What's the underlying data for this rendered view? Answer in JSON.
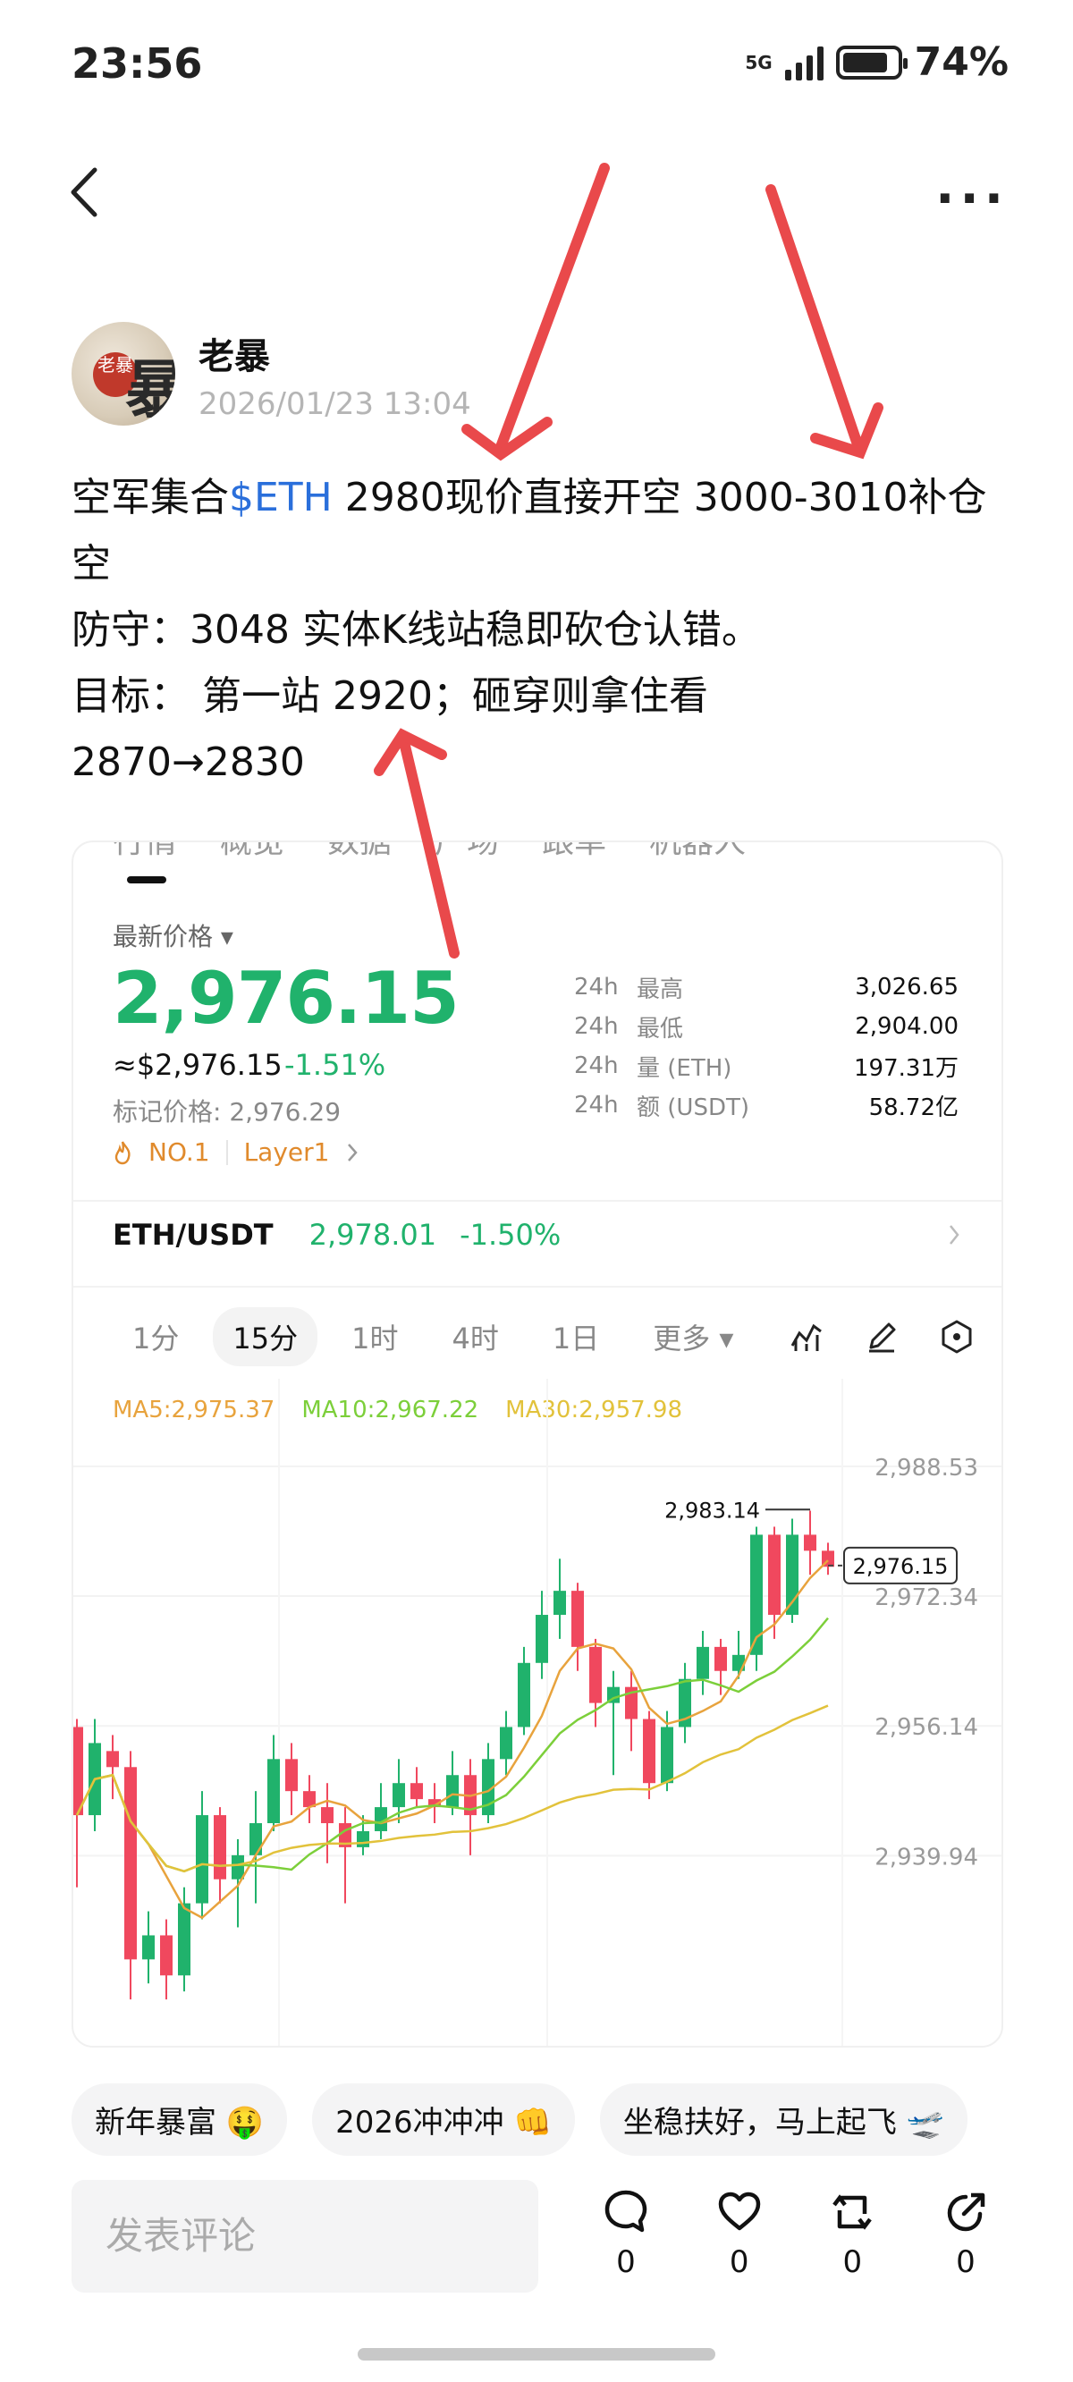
{
  "status": {
    "time": "23:56",
    "network": "5G",
    "battery": "74%",
    "battery_level": 0.74
  },
  "header": {
    "more_label": "···"
  },
  "author": {
    "name": "老暴",
    "timestamp": "2026/01/23 13:04",
    "avatar_text": "老暴"
  },
  "post": {
    "line1_prefix": "空军集合",
    "tag": "$ETH",
    "line1_suffix": " 2980现价直接开空 3000-3010补仓空",
    "line2": "防守：3048 实体K线站稳即砍仓认错。",
    "line3": "目标： 第一站 2920；砸穿则拿住看",
    "line4": "2870→2830"
  },
  "market": {
    "tabs": [
      "行情",
      "概览",
      "数据",
      "广场",
      "跟单",
      "机器人"
    ],
    "price_label": "最新价格 ▾",
    "price": "2,976.15",
    "price_usd": "≈$2,976.15",
    "change": "-1.51%",
    "mark_price": "标记价格: 2,976.29",
    "rank": "NO.1",
    "category": "Layer1",
    "stats": [
      {
        "k1": "24h",
        "k2": "最高",
        "v": "3,026.65"
      },
      {
        "k1": "24h",
        "k2": "最低",
        "v": "2,904.00"
      },
      {
        "k1": "24h",
        "k2": "量 (ETH)",
        "v": "197.31万"
      },
      {
        "k1": "24h",
        "k2": "额 (USDT)",
        "v": "58.72亿"
      }
    ],
    "pair": {
      "name": "ETH/USDT",
      "price": "2,978.01",
      "change": "-1.50%"
    },
    "timeframes": [
      "1分",
      "15分",
      "1时",
      "4时",
      "1日",
      "更多 ▾"
    ],
    "active_timeframe": "15分"
  },
  "chart_data": {
    "type": "candlestick",
    "ma": [
      {
        "name": "MA5:2,975.37",
        "color": "#e8a33d"
      },
      {
        "name": "MA10:2,967.22",
        "color": "#7ccf3a"
      },
      {
        "name": "MA30:2,957.98",
        "color": "#e2c23b"
      }
    ],
    "y_ticks": [
      "2,988.53",
      "2,972.34",
      "2,956.14",
      "2,939.94"
    ],
    "y_tick_values": [
      2988.53,
      2972.34,
      2956.14,
      2939.94
    ],
    "high_label": "2,983.14",
    "last_price_label": "2,976.15",
    "last_price": 2976.15,
    "high": 2983.14,
    "colors": {
      "up": "#20b26c",
      "down": "#f0485e"
    },
    "candles": [
      [
        2956,
        2945,
        2957,
        2936
      ],
      [
        2945,
        2954,
        2957,
        2943
      ],
      [
        2953,
        2951,
        2955,
        2947
      ],
      [
        2951,
        2927,
        2953,
        2922
      ],
      [
        2927,
        2930,
        2933,
        2924
      ],
      [
        2930,
        2925,
        2932,
        2922
      ],
      [
        2925,
        2934,
        2936,
        2923
      ],
      [
        2934,
        2945,
        2948,
        2932
      ],
      [
        2945,
        2937,
        2946,
        2934
      ],
      [
        2937,
        2940,
        2942,
        2931
      ],
      [
        2940,
        2944,
        2948,
        2934
      ],
      [
        2944,
        2952,
        2955,
        2943
      ],
      [
        2952,
        2948,
        2954,
        2945
      ],
      [
        2948,
        2946,
        2950,
        2944
      ],
      [
        2946,
        2944,
        2949,
        2939
      ],
      [
        2944,
        2941,
        2946,
        2934
      ],
      [
        2941,
        2943,
        2945,
        2940
      ],
      [
        2943,
        2946,
        2949,
        2942
      ],
      [
        2946,
        2949,
        2952,
        2944
      ],
      [
        2949,
        2947,
        2951,
        2946
      ],
      [
        2947,
        2946,
        2949,
        2944
      ],
      [
        2946,
        2950,
        2953,
        2945
      ],
      [
        2950,
        2945,
        2952,
        2940
      ],
      [
        2945,
        2952,
        2954,
        2944
      ],
      [
        2952,
        2956,
        2958,
        2950
      ],
      [
        2956,
        2964,
        2966,
        2955
      ],
      [
        2964,
        2970,
        2973,
        2962
      ],
      [
        2970,
        2973,
        2977,
        2967
      ],
      [
        2973,
        2966,
        2974,
        2963
      ],
      [
        2966,
        2959,
        2967,
        2956
      ],
      [
        2959,
        2961,
        2963,
        2950
      ],
      [
        2961,
        2957,
        2963,
        2953
      ],
      [
        2957,
        2949,
        2958,
        2947
      ],
      [
        2949,
        2956,
        2958,
        2948
      ],
      [
        2956,
        2962,
        2964,
        2954
      ],
      [
        2962,
        2966,
        2968,
        2960
      ],
      [
        2966,
        2963,
        2967,
        2960
      ],
      [
        2963,
        2965,
        2968,
        2962
      ],
      [
        2965,
        2980,
        2981,
        2963
      ],
      [
        2980,
        2970,
        2981,
        2967
      ],
      [
        2970,
        2980,
        2982,
        2969
      ],
      [
        2980,
        2978,
        2983,
        2975
      ],
      [
        2978,
        2976,
        2979,
        2975
      ]
    ]
  },
  "quick_replies": [
    "新年暴富 🤑",
    "2026冲冲冲 👊",
    "坐稳扶好，马上起飞 🛫"
  ],
  "comment": {
    "placeholder": "发表评论",
    "counts": {
      "comment": "0",
      "like": "0",
      "repost": "0",
      "share": "0"
    }
  }
}
